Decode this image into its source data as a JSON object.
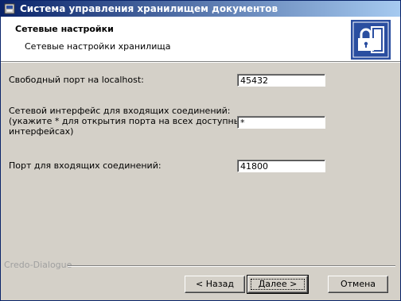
{
  "window": {
    "title": "Система управления хранилищем документов"
  },
  "header": {
    "title": "Сетевые настройки",
    "subtitle": "Сетевые настройки хранилища"
  },
  "form": {
    "port_label": "Свободный порт на localhost:",
    "port_value": "45432",
    "iface_label_1": "Сетевой интерфейс для входящих соединений:",
    "iface_label_2": "(укажите * для открытия порта на всех доступных",
    "iface_label_3": "интерфейсах)",
    "iface_value": "*",
    "incoming_port_label": "Порт для входящих соединений:",
    "incoming_port_value": "41800"
  },
  "footer": {
    "group_label": "Credo-Dialogue",
    "back_label": "< Назад",
    "next_label": "Далее >",
    "cancel_label": "Отмена"
  },
  "colors": {
    "title_bar": "#0a246a",
    "logo_blue": "#2a4ea0"
  },
  "icons": {
    "app": "app-icon",
    "logo": "lock-door-icon"
  }
}
